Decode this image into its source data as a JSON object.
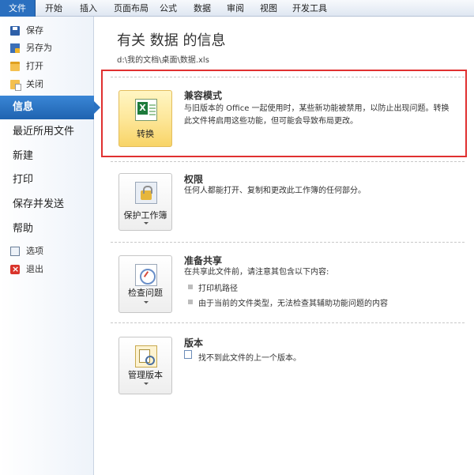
{
  "ribbon": {
    "tabs": [
      "文件",
      "开始",
      "插入",
      "页面布局",
      "公式",
      "数据",
      "审阅",
      "视图",
      "开发工具"
    ]
  },
  "nav": {
    "commands": [
      {
        "label": "保存",
        "icon": "save-icon"
      },
      {
        "label": "另存为",
        "icon": "save-as-icon"
      },
      {
        "label": "打开",
        "icon": "open-folder-icon"
      },
      {
        "label": "关闭",
        "icon": "close-file-icon"
      }
    ],
    "items": [
      "信息",
      "最近所用文件",
      "新建",
      "打印",
      "保存并发送",
      "帮助"
    ],
    "active": "信息",
    "bottom": [
      {
        "label": "选项",
        "icon": "options-icon"
      },
      {
        "label": "退出",
        "icon": "exit-icon"
      }
    ]
  },
  "info": {
    "title": "有关 数据 的信息",
    "path": "d:\\我的文档\\桌面\\数据.xls"
  },
  "sections": {
    "compat": {
      "button": "转换",
      "title": "兼容模式",
      "desc": "与旧版本的 Office 一起使用时，某些新功能被禁用，以防止出现问题。转换此文件将启用这些功能，但可能会导致布局更改。"
    },
    "perm": {
      "button": "保护工作簿",
      "title": "权限",
      "desc": "任何人都能打开、复制和更改此工作簿的任何部分。"
    },
    "share": {
      "button": "检查问题",
      "title": "准备共享",
      "desc": "在共享此文件前，请注意其包含以下内容:",
      "bullets": [
        "打印机路径",
        "由于当前的文件类型，无法检查其辅助功能问题的内容"
      ]
    },
    "version": {
      "button": "管理版本",
      "title": "版本",
      "desc": "找不到此文件的上一个版本。"
    }
  },
  "colors": {
    "file_tab": "#2a6fbf",
    "nav_active": "#2a72c2",
    "highlight_box": "#e03030",
    "convert_button": "#fde79a"
  }
}
